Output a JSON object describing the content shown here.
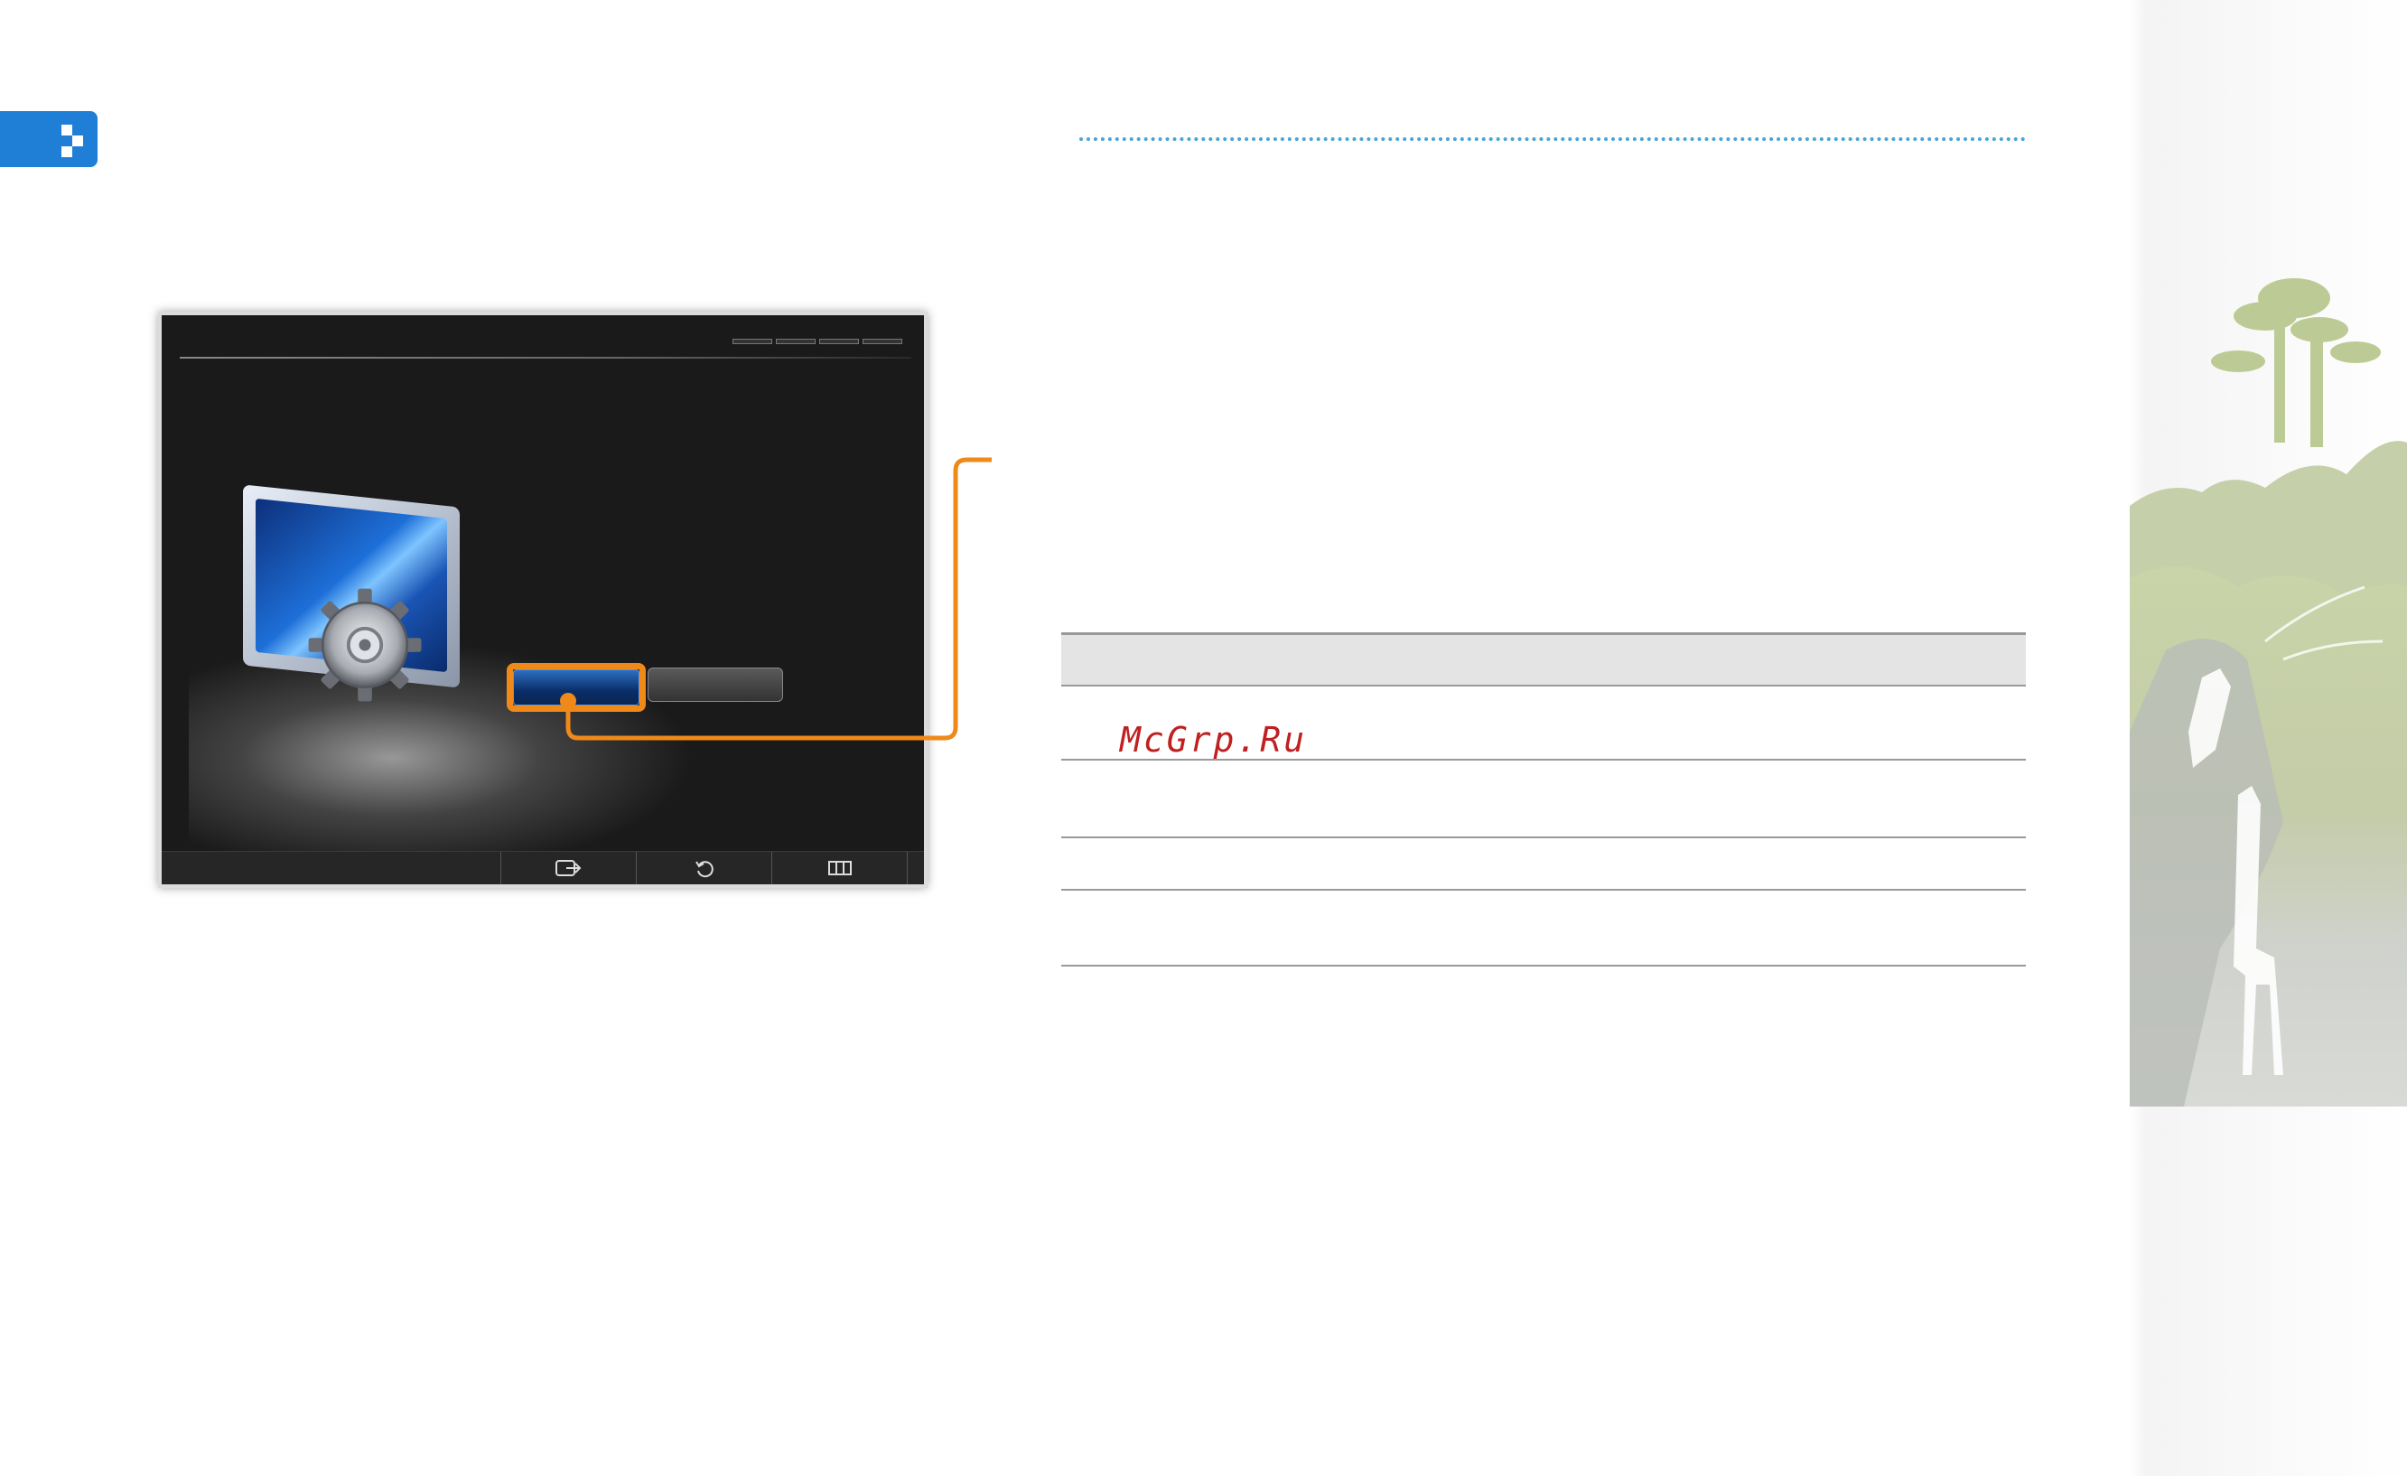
{
  "page": {
    "watermark": "McGrp.Ru",
    "accent_colors": {
      "tab_blue": "#1f7fd6",
      "dotted_rule": "#4aa3d8",
      "callout_orange": "#ef8a1a",
      "watermark_red": "#c02020"
    }
  },
  "tv_screen": {
    "selected_button_label": "",
    "other_button_label": "",
    "bottom_bar": [
      {
        "icon": "enter-icon",
        "label": ""
      },
      {
        "icon": "return-icon",
        "label": ""
      },
      {
        "icon": "menu-grid-icon",
        "label": ""
      }
    ]
  },
  "table": {
    "rows": [
      "",
      "",
      "",
      ""
    ]
  }
}
